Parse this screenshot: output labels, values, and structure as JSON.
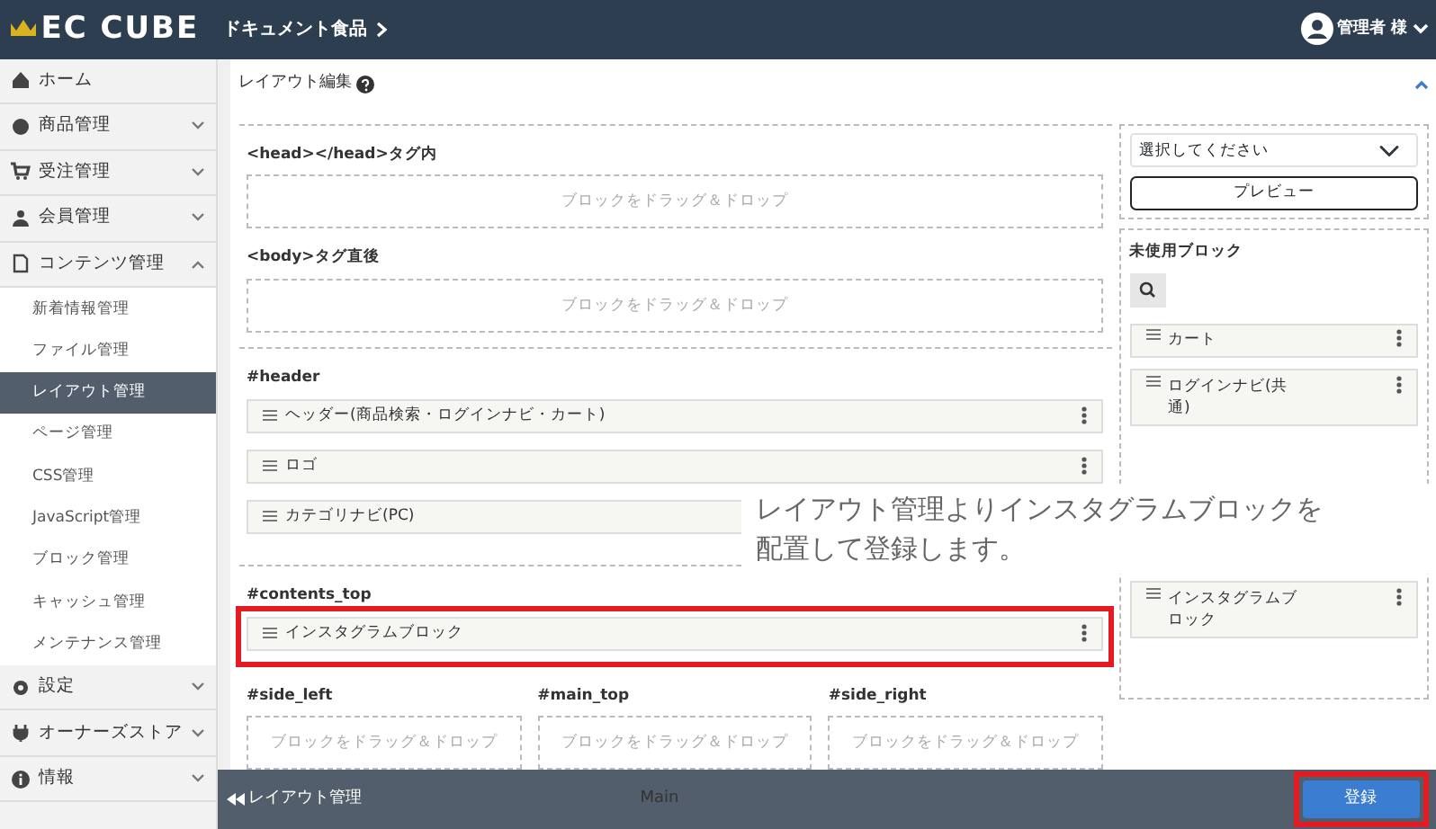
{
  "header": {
    "logo": "EC CUBE",
    "breadcrumb": "ドキュメント食品",
    "user": "管理者 様"
  },
  "sidebar": {
    "items": [
      {
        "label": "ホーム"
      },
      {
        "label": "商品管理",
        "expanded": false
      },
      {
        "label": "受注管理",
        "expanded": false
      },
      {
        "label": "会員管理",
        "expanded": false
      },
      {
        "label": "コンテンツ管理",
        "expanded": true,
        "children": [
          {
            "label": "新着情報管理",
            "selected": false
          },
          {
            "label": "ファイル管理",
            "selected": false
          },
          {
            "label": "レイアウト管理",
            "selected": true
          },
          {
            "label": "ページ管理",
            "selected": false
          },
          {
            "label": "CSS管理",
            "selected": false
          },
          {
            "label": "JavaScript管理",
            "selected": false
          },
          {
            "label": "ブロック管理",
            "selected": false
          },
          {
            "label": "キャッシュ管理",
            "selected": false
          },
          {
            "label": "メンテナンス管理",
            "selected": false
          }
        ]
      },
      {
        "label": "設定",
        "expanded": false
      },
      {
        "label": "オーナーズストア",
        "expanded": false
      },
      {
        "label": "情報",
        "expanded": false
      }
    ]
  },
  "panel": {
    "title": "レイアウト編集",
    "sections": [
      {
        "label": "<head></head>タグ内",
        "dropzone": "ブロックをドラッグ＆ドロップ"
      },
      {
        "label": "<body>タグ直後",
        "dropzone": "ブロックをドラッグ＆ドロップ"
      },
      {
        "label": "#header",
        "blocks": [
          {
            "name": "ヘッダー(商品検索・ログインナビ・カート)",
            "highlighted": false
          },
          {
            "name": "ロゴ",
            "highlighted": false
          },
          {
            "name": "カテゴリナビ(PC)",
            "highlighted": false
          }
        ]
      },
      {
        "label": "#contents_top",
        "blocks": [
          {
            "name": "インスタグラムブロック",
            "highlighted": true
          }
        ]
      }
    ],
    "columns": [
      {
        "label": "#side_left",
        "dropzone": "ブロックをドラッグ＆ドロップ"
      },
      {
        "label": "#main_top",
        "dropzone": "ブロックをドラッグ＆ドロップ"
      },
      {
        "label": "#side_right",
        "dropzone": "ブロックをドラッグ＆ドロップ"
      }
    ],
    "layout_select": {
      "placeholder": "選択してください"
    },
    "preview_button": "プレビュー",
    "unused": {
      "title": "未使用ブロック",
      "blocks": [
        {
          "name": "カート"
        },
        {
          "name": "ログインナビ(共通)"
        },
        {
          "name": "インスタグラムブロック"
        }
      ]
    }
  },
  "annotation": {
    "lines": [
      "レイアウト管理よりインスタグラムブロックを",
      "配置して登録します。"
    ]
  },
  "footer": {
    "back": "レイアウト管理",
    "label": "Main",
    "submit": {
      "label": "登録",
      "highlighted": true
    }
  }
}
